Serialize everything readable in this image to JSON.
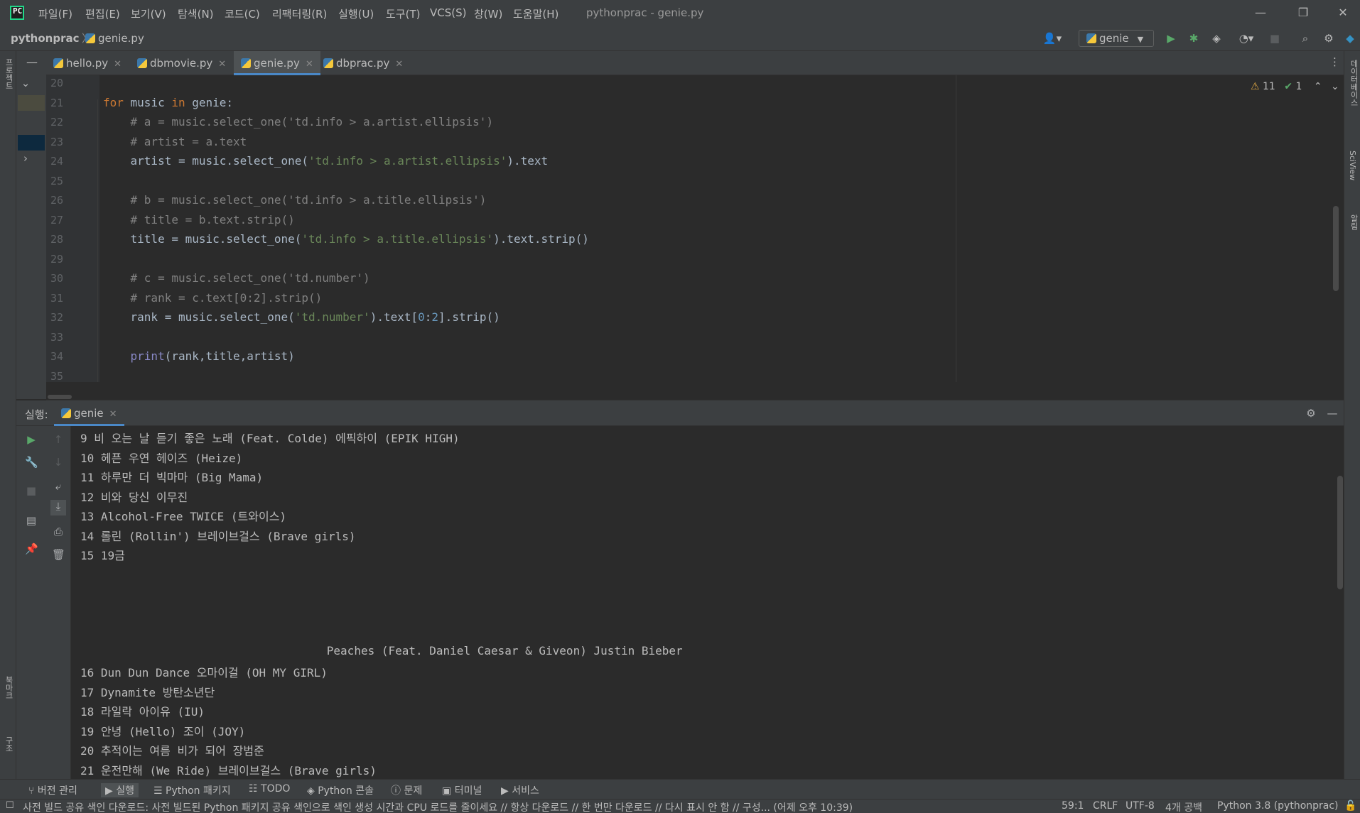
{
  "app": {
    "menu": [
      "파일(F)",
      "편집(E)",
      "보기(V)",
      "탐색(N)",
      "코드(C)",
      "리팩터링(R)",
      "실행(U)",
      "도구(T)",
      "VCS(S)",
      "창(W)",
      "도움말(H)"
    ],
    "window_title": "pythonprac - genie.py",
    "window_controls": [
      "—",
      "❐",
      "✕"
    ]
  },
  "breadcrumb": {
    "project": "pythonprac",
    "file": "genie.py"
  },
  "toolbar": {
    "run_config": "genie"
  },
  "tabs": [
    {
      "label": "hello.py",
      "active": false
    },
    {
      "label": "dbmovie.py",
      "active": false
    },
    {
      "label": "genie.py",
      "active": true
    },
    {
      "label": "dbprac.py",
      "active": false
    }
  ],
  "inspections": {
    "warnings": "11",
    "checks": "1"
  },
  "editor": {
    "line_numbers": [
      "20",
      "21",
      "22",
      "23",
      "24",
      "25",
      "26",
      "27",
      "28",
      "29",
      "30",
      "31",
      "32",
      "33",
      "34",
      "35"
    ]
  },
  "run": {
    "label": "실행:",
    "tab": "genie"
  },
  "console": {
    "lines": [
      "9 비 오는 날 듣기 좋은 노래 (Feat. Colde) 에픽하이 (EPIK HIGH)",
      "10 헤픈 우연 헤이즈 (Heize)",
      "11 하루만 더 빅마마 (Big Mama)",
      "12 비와 당신 이무진",
      "13 Alcohol-Free TWICE (트와이스)",
      "14 롤린 (Rollin') 브레이브걸스 (Brave girls)",
      "15 19금",
      "",
      "",
      "",
      "",
      "                                    Peaches (Feat. Daniel Caesar & Giveon) Justin Bieber",
      "16 Dun Dun Dance 오마이걸 (OH MY GIRL)",
      "17 Dynamite 방탄소년단",
      "18 라일락 아이유 (IU)",
      "19 안녕 (Hello) 조이 (JOY)",
      "20 추적이는 여름 비가 되어 장범준",
      "21 운전만해 (We Ride) 브레이브걸스 (Brave girls)"
    ]
  },
  "toolwindows": [
    "버전 관리",
    "실행",
    "Python 패키지",
    "TODO",
    "Python 콘솔",
    "문제",
    "터미널",
    "서비스"
  ],
  "status": {
    "message": "사전 빌드 공유 색인 다운로드: 사전 빌드된 Python 패키지 공유 색인으로 색인 생성 시간과 CPU 로드를 줄이세요 // 항상 다운로드 // 한 번만 다운로드 // 다시 표시 안 함 // 구성... (어제 오후 10:39)",
    "position": "59:1",
    "line_sep": "CRLF",
    "encoding": "UTF-8",
    "indent": "4개 공백",
    "interpreter": "Python 3.8 (pythonprac)"
  },
  "side_labels": {
    "left_top": "프로젝트",
    "left_bookmark": "북마크",
    "left_structure": "구조",
    "right_db": "데이터베이스",
    "right_sci": "SciView",
    "right_notify": "알림"
  }
}
